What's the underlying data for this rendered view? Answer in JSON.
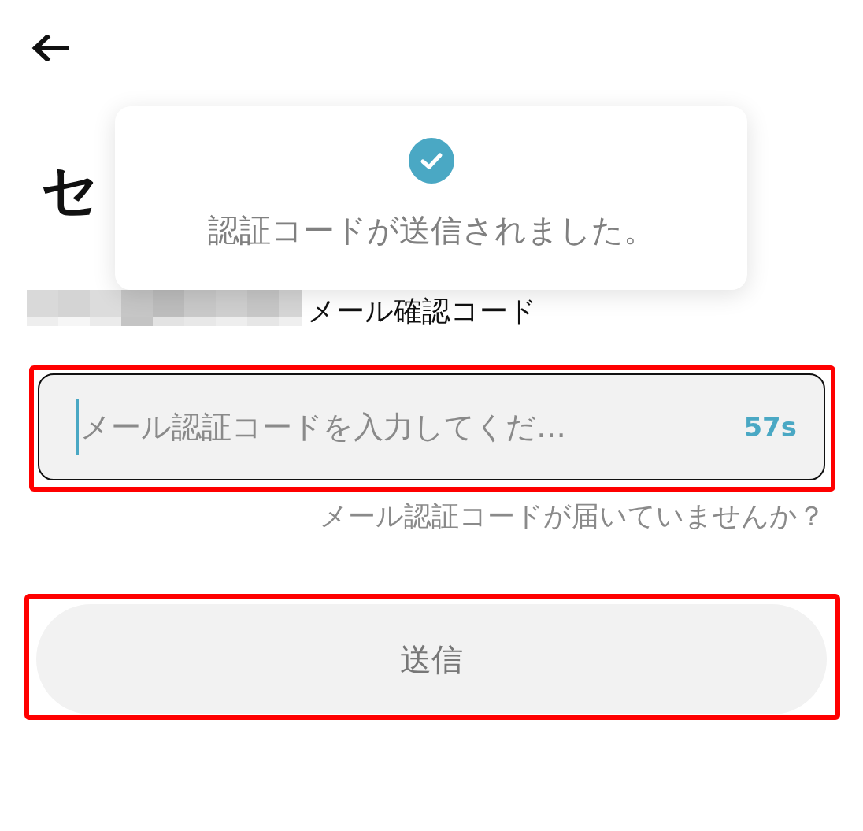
{
  "title": "セ",
  "toast": {
    "message": "認証コードが送信されました。"
  },
  "email_label": "メール確認コード",
  "code_field": {
    "placeholder": "メール認証コードを入力してくだ…",
    "countdown": "57s"
  },
  "resend_link": "メール認証コードが届いていませんか？",
  "submit_button": {
    "label": "送信"
  }
}
